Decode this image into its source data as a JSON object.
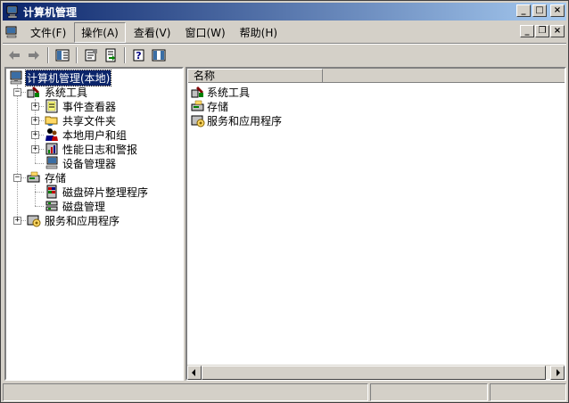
{
  "window": {
    "title": "计算机管理"
  },
  "menu": [
    {
      "label": "文件(F)"
    },
    {
      "label": "操作(A)"
    },
    {
      "label": "查看(V)"
    },
    {
      "label": "窗口(W)"
    },
    {
      "label": "帮助(H)"
    }
  ],
  "active_menu_index": 1,
  "tree": {
    "root": "计算机管理(本地)",
    "system_tools": "系统工具",
    "event_viewer": "事件查看器",
    "shared_folders": "共享文件夹",
    "local_users_groups": "本地用户和组",
    "perf_logs_alerts": "性能日志和警报",
    "device_manager": "设备管理器",
    "storage": "存储",
    "disk_defrag": "磁盘碎片整理程序",
    "disk_management": "磁盘管理",
    "services_apps": "服务和应用程序"
  },
  "list": {
    "column_name": "名称",
    "items": [
      "系统工具",
      "存储",
      "服务和应用程序"
    ]
  },
  "icons": {
    "app": "computer-management-icon",
    "back": "back-arrow-icon",
    "forward": "forward-arrow-icon"
  },
  "colors": {
    "title_start": "#0a246a",
    "title_end": "#a6caf0",
    "selection": "#0a246a",
    "face": "#d4d0c8"
  }
}
